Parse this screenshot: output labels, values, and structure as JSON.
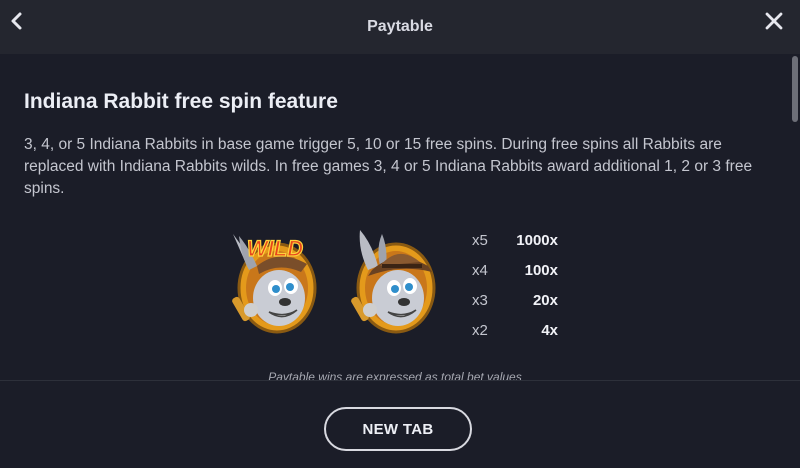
{
  "header": {
    "title": "Paytable",
    "back_icon": "chevron-left-icon",
    "close_icon": "close-icon"
  },
  "section": {
    "heading": "Indiana Rabbit free spin feature",
    "description": "3, 4, or 5 Indiana Rabbits in base game trigger 5, 10 or 15 free spins. During free spins all Rabbits are replaced with Indiana Rabbits wilds. In free games 3, 4 or 5 Indiana Rabbits award additional 1, 2 or 3 free spins.",
    "symbols": [
      {
        "name": "indiana-rabbit-wild-symbol",
        "label": "WILD"
      },
      {
        "name": "indiana-rabbit-symbol",
        "label": ""
      }
    ],
    "paytable": [
      {
        "count": "x5",
        "payout": "1000x"
      },
      {
        "count": "x4",
        "payout": "100x"
      },
      {
        "count": "x3",
        "payout": "20x"
      },
      {
        "count": "x2",
        "payout": "4x"
      }
    ],
    "footnote": "Paytable wins are expressed as total bet values"
  },
  "footer": {
    "new_tab_label": "NEW TAB"
  },
  "colors": {
    "background": "#1b1d28",
    "header": "#24262f",
    "wild_text": "#e8461c",
    "hat": "#7a4e2a",
    "medallion": "#e49a1b"
  }
}
